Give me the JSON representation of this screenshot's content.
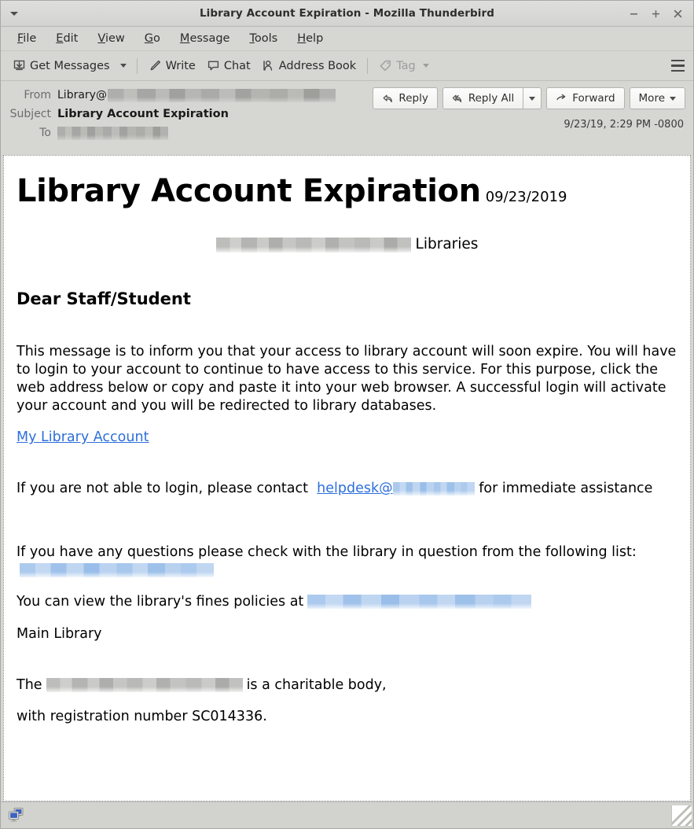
{
  "window": {
    "title": "Library Account Expiration - Mozilla Thunderbird",
    "menu_caret_icon": "chevron-down-icon",
    "minimize_label": "−",
    "maximize_label": "+",
    "close_label": "✕"
  },
  "menubar": {
    "items": [
      {
        "label": "File",
        "accel": "F"
      },
      {
        "label": "Edit",
        "accel": "E"
      },
      {
        "label": "View",
        "accel": "V"
      },
      {
        "label": "Go",
        "accel": "G"
      },
      {
        "label": "Message",
        "accel": "M"
      },
      {
        "label": "Tools",
        "accel": "T"
      },
      {
        "label": "Help",
        "accel": "H"
      }
    ]
  },
  "toolbar": {
    "get_messages_label": "Get Messages",
    "get_messages_icon": "inbox-download-icon",
    "get_messages_caret_icon": "chevron-down-icon",
    "write_label": "Write",
    "write_icon": "pencil-icon",
    "chat_label": "Chat",
    "chat_icon": "speech-bubble-icon",
    "address_book_label": "Address Book",
    "address_book_icon": "person-book-icon",
    "tag_label": "Tag",
    "tag_icon": "tag-icon",
    "tag_caret_icon": "chevron-down-icon",
    "tag_disabled": true,
    "app_menu_icon": "hamburger-menu-icon"
  },
  "message_header": {
    "from_label": "From",
    "from_value": "Library@",
    "from_redacted": true,
    "subject_label": "Subject",
    "subject_value": "Library Account Expiration",
    "to_label": "To",
    "to_redacted": true,
    "date": "9/23/19, 2:29 PM -0800",
    "actions": {
      "reply_label": "Reply",
      "reply_icon": "reply-arrow-icon",
      "reply_all_label": "Reply All",
      "reply_all_icon": "reply-all-arrow-icon",
      "reply_all_caret_icon": "chevron-down-icon",
      "forward_label": "Forward",
      "forward_icon": "forward-arrow-icon",
      "more_label": "More",
      "more_caret_icon": "chevron-down-icon"
    }
  },
  "message_body": {
    "title": "Library Account Expiration",
    "title_date": "09/23/2019",
    "org_suffix": "Libraries",
    "greeting": "Dear Staff/Student",
    "paragraph_1": "This message is to inform you that your access to library account will soon expire. You will have to login to your account to continue to have access to this service. For this purpose, click the web address below or copy and paste it into your web browser. A successful login will activate your account and you will be redirected to library databases.",
    "account_link_label": "My Library Account",
    "contact_prefix": "If you are not able to login, please contact",
    "contact_email_visible": "helpdesk@",
    "contact_suffix": "for immediate assistance",
    "questions_text": "If you have any questions please check with the library in question from the following list:",
    "fines_prefix": "You can view the library's fines policies at",
    "main_library": "Main Library",
    "charity_prefix": "The",
    "charity_suffix": "is a charitable body,",
    "registration_text": "with registration number SC014336."
  },
  "statusbar": {
    "connection_icon": "network-monitors-icon",
    "resize_grip_icon": "resize-grip-icon"
  },
  "colors": {
    "chrome": "#d6d6d3",
    "titlebar": "#dedede",
    "link": "#2d6fdb",
    "text": "#1a1a1a",
    "label_muted": "#6d6d6d",
    "redaction_grey": "#c9c9c6",
    "redaction_blue": "#cfe0f4"
  }
}
